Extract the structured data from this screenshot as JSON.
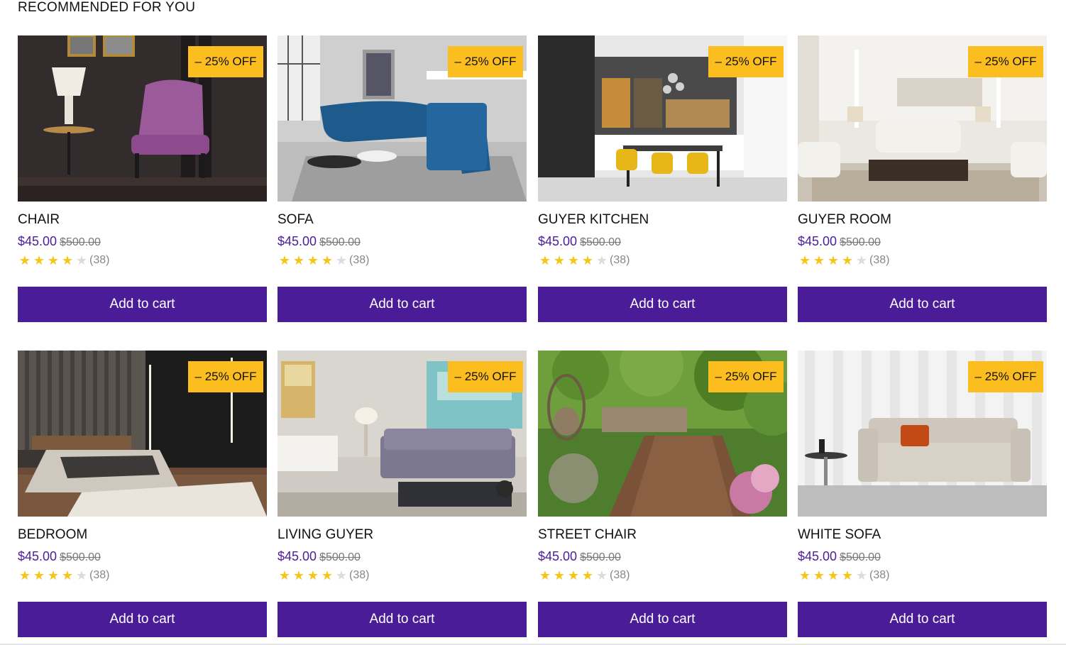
{
  "section": {
    "title": "RECOMMENDED FOR YOU"
  },
  "colors": {
    "accent": "#4b1c98",
    "badge": "#fcbd1e",
    "star": "#f5c518"
  },
  "products": [
    {
      "name": "CHAIR",
      "badge": "– 25% OFF",
      "price": "$45.00",
      "old_price": "$500.00",
      "stars": 4,
      "reviews": "(38)",
      "button": "Add to cart",
      "image": "armchair-room-image"
    },
    {
      "name": "SOFA",
      "badge": "– 25% OFF",
      "price": "$45.00",
      "old_price": "$500.00",
      "stars": 4,
      "reviews": "(38)",
      "button": "Add to cart",
      "image": "sectional-sofa-image"
    },
    {
      "name": "GUYER KITCHEN",
      "badge": "– 25% OFF",
      "price": "$45.00",
      "old_price": "$500.00",
      "stars": 4,
      "reviews": "(38)",
      "button": "Add to cart",
      "image": "kitchen-image"
    },
    {
      "name": "GUYER ROOM",
      "badge": "– 25% OFF",
      "price": "$45.00",
      "old_price": "$500.00",
      "stars": 4,
      "reviews": "(38)",
      "button": "Add to cart",
      "image": "living-room-image"
    },
    {
      "name": "BEDROOM",
      "badge": "– 25% OFF",
      "price": "$45.00",
      "old_price": "$500.00",
      "stars": 4,
      "reviews": "(38)",
      "button": "Add to cart",
      "image": "bedroom-image"
    },
    {
      "name": "LIVING GUYER",
      "badge": "– 25% OFF",
      "price": "$45.00",
      "old_price": "$500.00",
      "stars": 4,
      "reviews": "(38)",
      "button": "Add to cart",
      "image": "lounge-image"
    },
    {
      "name": "STREET CHAIR",
      "badge": "– 25% OFF",
      "price": "$45.00",
      "old_price": "$500.00",
      "stars": 4,
      "reviews": "(38)",
      "button": "Add to cart",
      "image": "garden-chair-image"
    },
    {
      "name": "WHITE SOFA",
      "badge": "– 25% OFF",
      "price": "$45.00",
      "old_price": "$500.00",
      "stars": 4,
      "reviews": "(38)",
      "button": "Add to cart",
      "image": "white-sofa-image"
    }
  ]
}
